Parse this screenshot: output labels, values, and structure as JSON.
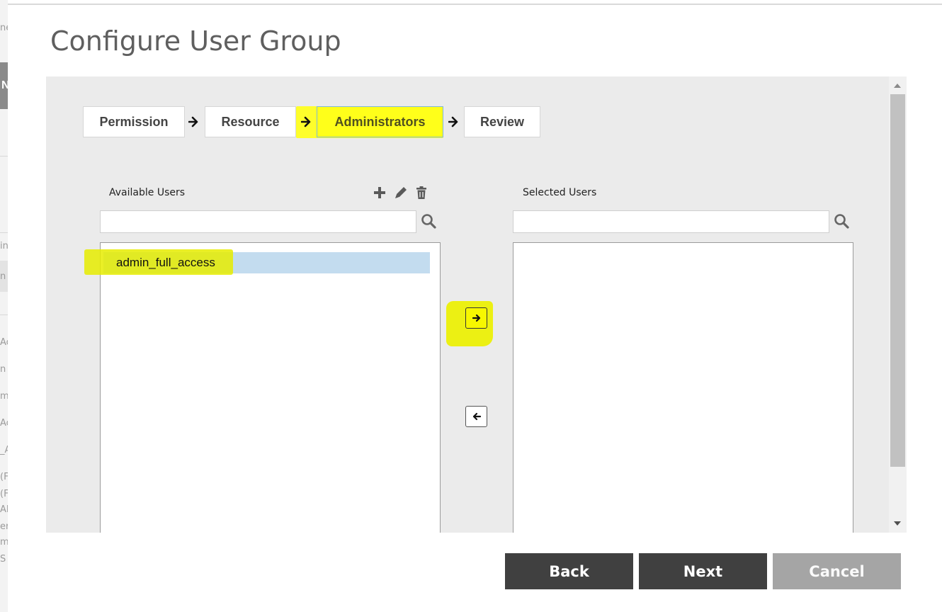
{
  "background": {
    "fragments": [
      "ne",
      "N",
      "in",
      "n",
      "Ac",
      "n",
      "mi",
      "Ac",
      "_A",
      "(F",
      "(F",
      "AN",
      "er/",
      "mi",
      "S"
    ]
  },
  "dialog": {
    "title": "Configure User Group"
  },
  "wizard": {
    "steps": [
      {
        "label": "Permission"
      },
      {
        "label": "Resource"
      },
      {
        "label": "Administrators",
        "active": true
      },
      {
        "label": "Review"
      }
    ]
  },
  "available": {
    "label": "Available Users",
    "search_value": "",
    "items": [
      "admin_full_access"
    ]
  },
  "selected": {
    "label": "Selected Users",
    "search_value": "",
    "items": []
  },
  "footer": {
    "back": "Back",
    "next": "Next",
    "cancel": "Cancel"
  },
  "colors": {
    "highlight": "#ffff1a",
    "panel_bg": "#ebebeb",
    "selected_row": "#c3dcef",
    "primary_button": "#404040",
    "disabled_button": "#a5a5a5"
  },
  "icons": {
    "add": "plus-icon",
    "edit": "pencil-icon",
    "delete": "trash-icon",
    "search": "magnifier-icon",
    "move_right": "arrow-right-icon",
    "move_left": "arrow-left-icon"
  }
}
